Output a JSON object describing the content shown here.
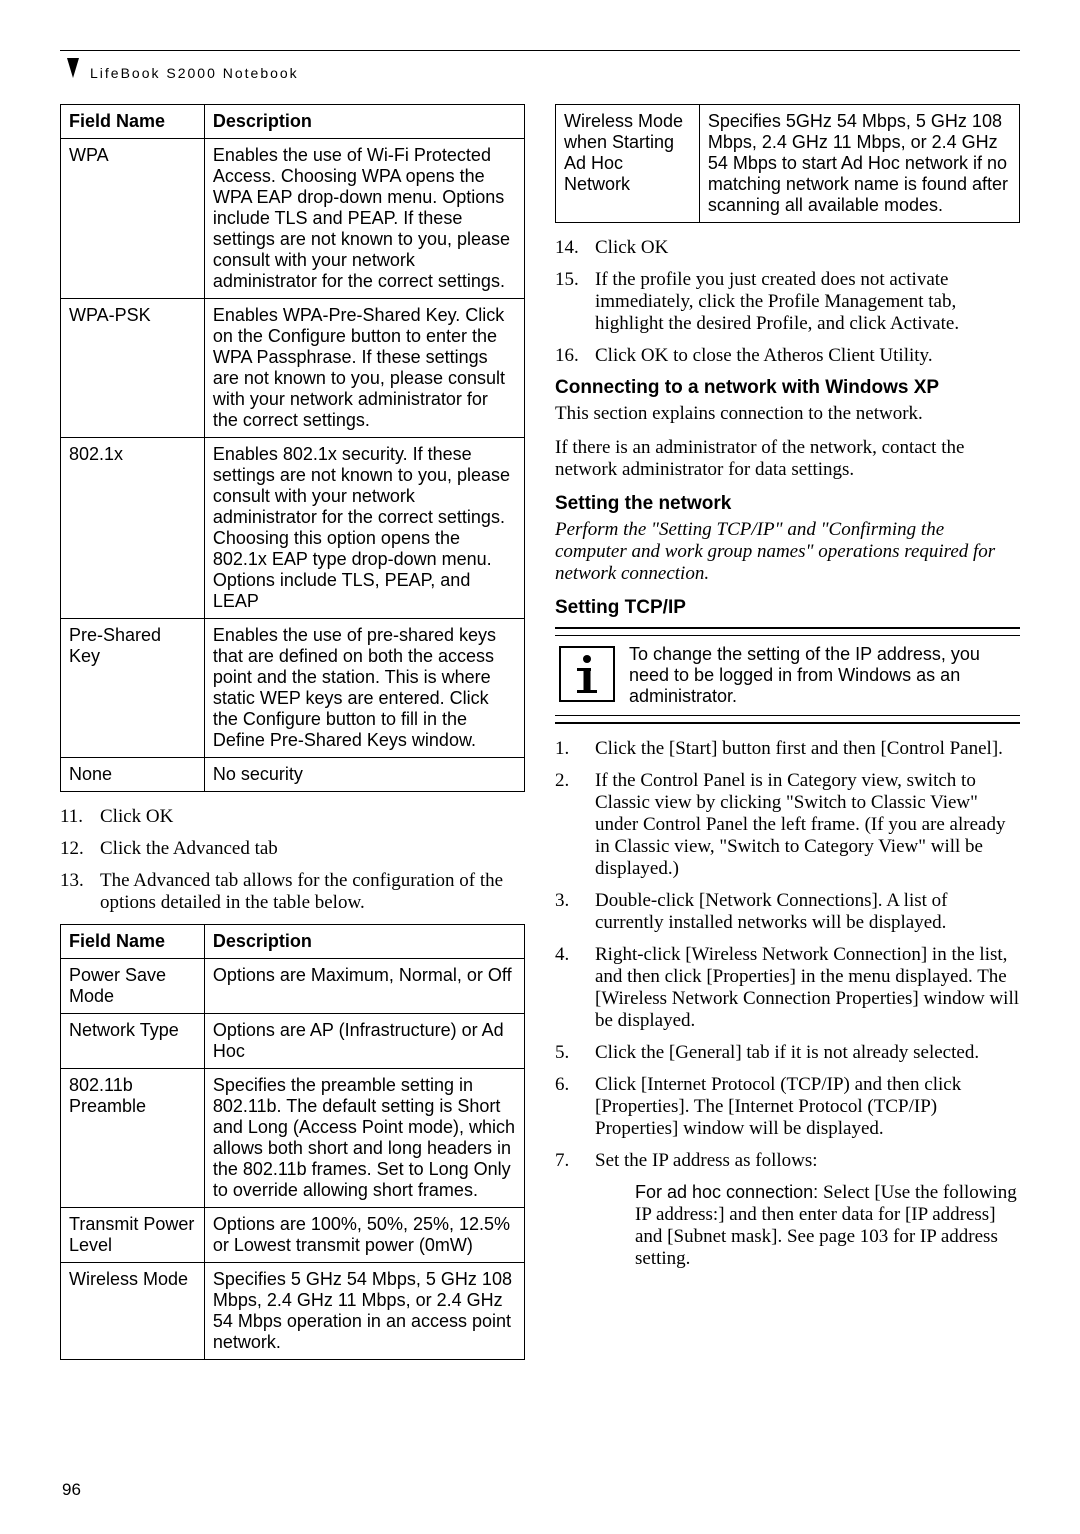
{
  "running_head": "LifeBook S2000 Notebook",
  "page_number": "96",
  "table1": {
    "headers": [
      "Field Name",
      "Description"
    ],
    "rows": [
      {
        "field": "WPA",
        "desc": "Enables the use of Wi-Fi Protected Access. Choosing WPA opens the WPA EAP drop-down menu. Options include TLS and PEAP. If these settings are not known to you, please consult with your network administrator for the correct settings."
      },
      {
        "field": "WPA-PSK",
        "desc": "Enables WPA-Pre-Shared Key. Click on the Configure button to enter the WPA Passphrase. If these settings are not known to you, please consult with your network administrator for the correct settings."
      },
      {
        "field": "802.1x",
        "desc": "Enables 802.1x security. If these settings are not known to you, please consult with your network administrator for the correct settings. Choosing this option opens the 802.1x EAP type drop-down menu. Options include TLS, PEAP, and LEAP"
      },
      {
        "field": "Pre-Shared Key",
        "desc": "Enables the use of pre-shared keys that are defined on both the access point and the station. This is where static WEP keys are entered. Click the Configure button to fill in the Define Pre-Shared Keys window."
      },
      {
        "field": "None",
        "desc": "No security"
      }
    ]
  },
  "ol_left": [
    {
      "num": "11.",
      "txt": "Click OK"
    },
    {
      "num": "12.",
      "txt": "Click the Advanced tab"
    },
    {
      "num": "13.",
      "txt": "The Advanced tab allows for the configuration of the options detailed in the table below."
    }
  ],
  "table2": {
    "headers": [
      "Field Name",
      "Description"
    ],
    "rows": [
      {
        "field": "Power Save Mode",
        "desc": "Options are Maximum, Normal, or Off"
      },
      {
        "field": "Network Type",
        "desc": "Options are AP (Infrastructure) or Ad Hoc"
      },
      {
        "field": "802.11b Preamble",
        "desc": "Specifies the preamble setting in 802.11b. The default setting is Short and Long (Access Point mode), which allows both short and long headers in the 802.11b frames. Set to Long Only to override allowing short frames."
      },
      {
        "field": "Transmit Power Level",
        "desc": "Options are 100%, 50%, 25%, 12.5% or Lowest transmit power (0mW)"
      },
      {
        "field": "Wireless Mode",
        "desc": "Specifies 5 GHz 54 Mbps, 5 GHz 108 Mbps, 2.4 GHz 11 Mbps, or 2.4 GHz 54 Mbps operation in an access point network."
      }
    ]
  },
  "table3": {
    "rows": [
      {
        "field": "Wireless Mode when Starting Ad Hoc Network",
        "desc": "Specifies 5GHz 54 Mbps, 5 GHz 108 Mbps, 2.4 GHz 11 Mbps, or 2.4 GHz 54 Mbps to start Ad Hoc network if no matching network name is found after scanning all available modes."
      }
    ]
  },
  "ol_right1": [
    {
      "num": "14.",
      "txt": "Click OK"
    },
    {
      "num": "15.",
      "txt": "If the profile you just created does not activate immediately, click the Profile Management tab, highlight the desired Profile, and click Activate."
    },
    {
      "num": "16.",
      "txt": "Click OK to close the Atheros Client Utility."
    }
  ],
  "h_connecting": "Connecting to a network with Windows XP",
  "p_connecting": "This section explains connection to the network.",
  "p_admin": "If there is an administrator of the network, contact the network administrator for data settings.",
  "h_setting_net": "Setting the network",
  "p_setting_net_ital": "Perform the \"Setting TCP/IP\" and \"Confirming the computer and work group names\" operations required for network connection.",
  "h_tcpip": "Setting TCP/IP",
  "note_text": "To change the setting of the IP address, you need to be logged in from Windows as an administrator.",
  "ol_right2": [
    {
      "num": "1.",
      "txt": "Click the [Start] button first and then [Control Panel]."
    },
    {
      "num": "2.",
      "txt": "If the Control Panel is in Category view, switch to Classic view by clicking \"Switch to Classic View\" under Control Panel the left frame. (If you are already in Classic view, \"Switch to Category View\" will be displayed.)"
    },
    {
      "num": "3.",
      "txt": "Double-click [Network Connections]. A list of currently installed networks will be displayed."
    },
    {
      "num": "4.",
      "txt": "Right-click [Wireless Network Connection] in the list, and then click [Properties] in the menu displayed. The [Wireless Network Connection Properties] window will be displayed."
    },
    {
      "num": "5.",
      "txt": "Click the [General] tab if it is not already selected."
    },
    {
      "num": "6.",
      "txt": "Click [Internet Protocol (TCP/IP) and then click [Properties]. The [Internet Protocol (TCP/IP) Properties] window will be displayed."
    },
    {
      "num": "7.",
      "txt": "Set the IP address as follows:"
    }
  ],
  "sub_adhoc_label": "For ad hoc connection:",
  "sub_adhoc_body": "Select [Use the following IP address:] and then enter data for [IP address] and [Subnet mask]. See page 103 for IP address setting."
}
